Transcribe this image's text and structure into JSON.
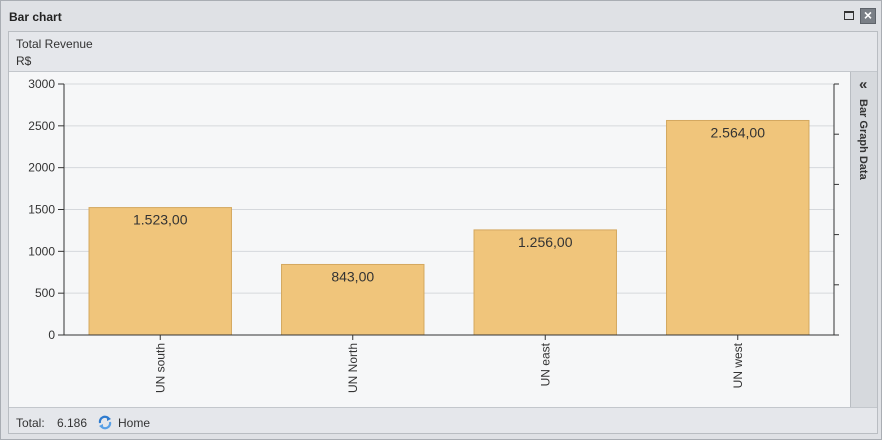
{
  "window": {
    "title": "Bar chart"
  },
  "header": {
    "title": "Total Revenue",
    "unit": "R$"
  },
  "side_panel": {
    "label": "Bar Graph Data",
    "arrow": "«"
  },
  "footer": {
    "total_label": "Total:",
    "total_value": "6.186",
    "home_label": "Home",
    "home_icon": "home-refresh-icon"
  },
  "colors": {
    "bar": "#f0c57b",
    "bar_border": "#d4a85f",
    "grid": "#d5d8dc",
    "axis": "#333333"
  },
  "chart_data": {
    "type": "bar",
    "title": "Total Revenue",
    "ylabel": "R$",
    "xlabel": "",
    "categories": [
      "UN south",
      "UN North",
      "UN east",
      "UN west"
    ],
    "values": [
      1523,
      843,
      1256,
      2564
    ],
    "data_labels": [
      "1.523,00",
      "843,00",
      "1.256,00",
      "2.564,00"
    ],
    "ylim": [
      0,
      3000
    ],
    "yticks": [
      0,
      500,
      1000,
      1500,
      2000,
      2500,
      3000
    ],
    "grid": true
  }
}
